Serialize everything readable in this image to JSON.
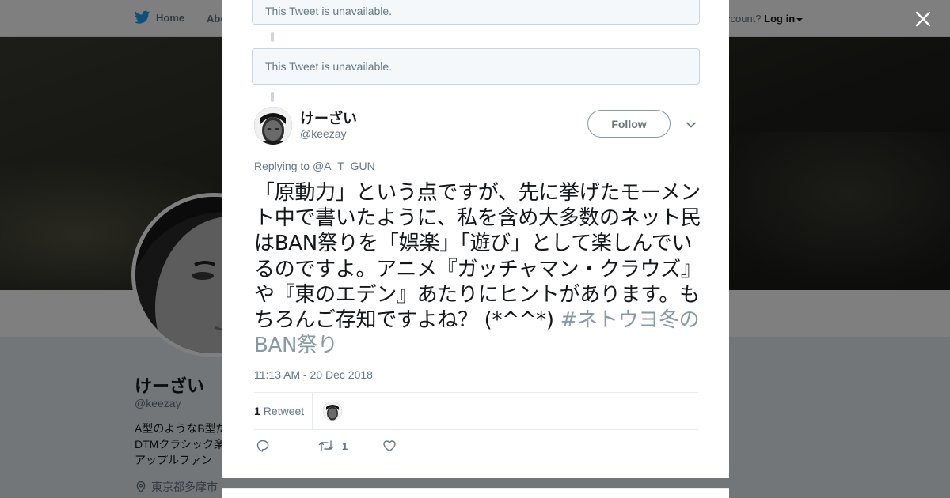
{
  "navbar": {
    "home_label": "Home",
    "about_label": "Abo",
    "account_prompt": "ccount?",
    "login_label": "Log in"
  },
  "profile": {
    "name": "けーざい",
    "handle": "@keezay",
    "bio_lines": [
      "A型のようなB型だ",
      "DTMクラシック楽",
      "アップルファン"
    ],
    "location": "東京都多摩市"
  },
  "modal": {
    "unavailable_1": "This Tweet is unavailable.",
    "unavailable_2": "This Tweet is unavailable.",
    "tweet": {
      "author_name": "けーざい",
      "author_handle": "@keezay",
      "follow_label": "Follow",
      "replying_prefix": "Replying to",
      "replying_to": "@A_T_GUN",
      "text": "「原動力」という点ですが、先に挙げたモーメント中で書いたように、私を含め大多数のネット民はBAN祭りを「娯楽」「遊び」として楽しんでいるのですよ。アニメ『ガッチャマン・クラウズ』や『東のエデン』あたりにヒントがあります。もちろんご存知ですよね？ (*^^*) ",
      "hashtag": "#ネトウヨ冬のBAN祭り",
      "timestamp": "11:13 AM - 20 Dec 2018",
      "retweet_count": "1",
      "retweet_label": "Retweet",
      "action_retweet_count": "1"
    }
  },
  "colors": {
    "brand_blue": "#1da1f2",
    "text_primary": "#14171a",
    "text_secondary": "#657786",
    "hashtag": "#8899a6"
  },
  "icons": {
    "logo": "twitter-bird-icon",
    "close": "close-icon",
    "caret": "chevron-down-icon",
    "reply": "reply-icon",
    "retweet": "retweet-icon",
    "like": "heart-icon",
    "location": "location-pin-icon"
  }
}
